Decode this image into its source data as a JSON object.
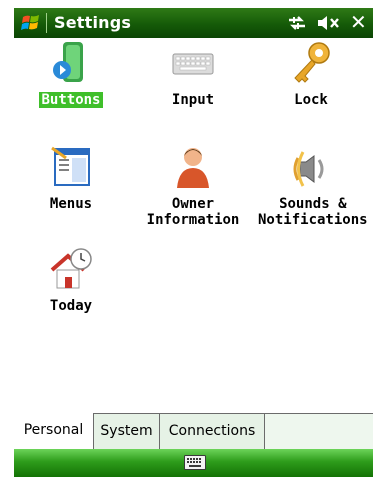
{
  "titlebar": {
    "title": "Settings",
    "icons": [
      "windows-flag-icon",
      "connectivity-icon",
      "volume-icon",
      "close-icon"
    ],
    "close_label": "✕"
  },
  "tiles": [
    {
      "name": "buttons",
      "label": "Buttons",
      "icon": "buttons-icon",
      "selected": true
    },
    {
      "name": "input",
      "label": "Input",
      "icon": "keyboard-icon",
      "selected": false
    },
    {
      "name": "lock",
      "label": "Lock",
      "icon": "key-icon",
      "selected": false
    },
    {
      "name": "menus",
      "label": "Menus",
      "icon": "menus-icon",
      "selected": false
    },
    {
      "name": "owner-information",
      "label": "Owner\nInformation",
      "icon": "owner-icon",
      "selected": false
    },
    {
      "name": "sounds-notifications",
      "label": "Sounds &\nNotifications",
      "icon": "speaker-icon",
      "selected": false
    },
    {
      "name": "today",
      "label": "Today",
      "icon": "today-icon",
      "selected": false
    }
  ],
  "tabs": [
    {
      "label": "Personal",
      "active": true
    },
    {
      "label": "System",
      "active": false
    },
    {
      "label": "Connections",
      "active": false
    }
  ],
  "bottombar": {
    "icon": "keyboard-icon"
  },
  "colors": {
    "titlebar": "#155a08",
    "selected_label": "#3fbf2a",
    "bottombar": "#2e9c1b",
    "tabstrip": "#eef7ee"
  }
}
